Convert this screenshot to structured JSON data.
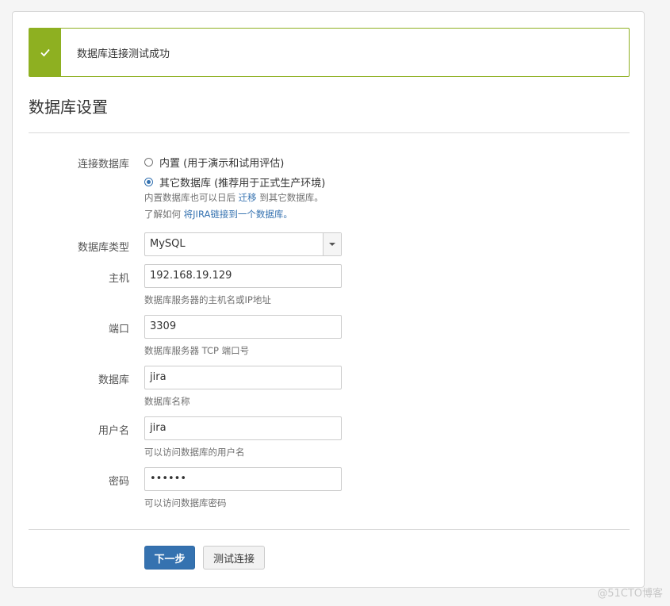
{
  "alert": {
    "message": "数据库连接测试成功",
    "icon": "checkmark-icon",
    "color": "#8eb021"
  },
  "page_title": "数据库设置",
  "connect_db": {
    "label": "连接数据库",
    "options": [
      {
        "label": "内置 (用于演示和试用评估)",
        "checked": false
      },
      {
        "label": "其它数据库 (推荐用于正式生产环境)",
        "checked": true
      }
    ],
    "help1_prefix": "内置数据库也可以日后 ",
    "help1_link": "迁移",
    "help1_suffix": " 到其它数据库。",
    "help2_prefix": "了解如何 ",
    "help2_link": "将JIRA链接到一个数据库。"
  },
  "db_type": {
    "label": "数据库类型",
    "value": "MySQL"
  },
  "host": {
    "label": "主机",
    "value": "192.168.19.129",
    "help": "数据库服务器的主机名或IP地址"
  },
  "port": {
    "label": "端口",
    "value": "3309",
    "help": "数据库服务器 TCP 端口号"
  },
  "database": {
    "label": "数据库",
    "value": "jira",
    "help": "数据库名称"
  },
  "username": {
    "label": "用户名",
    "value": "jira",
    "help": "可以访问数据库的用户名"
  },
  "password": {
    "label": "密码",
    "value": "••••••",
    "help": "可以访问数据库密码"
  },
  "buttons": {
    "next": "下一步",
    "test": "测试连接"
  },
  "watermark": "@51CTO博客",
  "colors": {
    "accent": "#3572b0",
    "success": "#8eb021"
  }
}
